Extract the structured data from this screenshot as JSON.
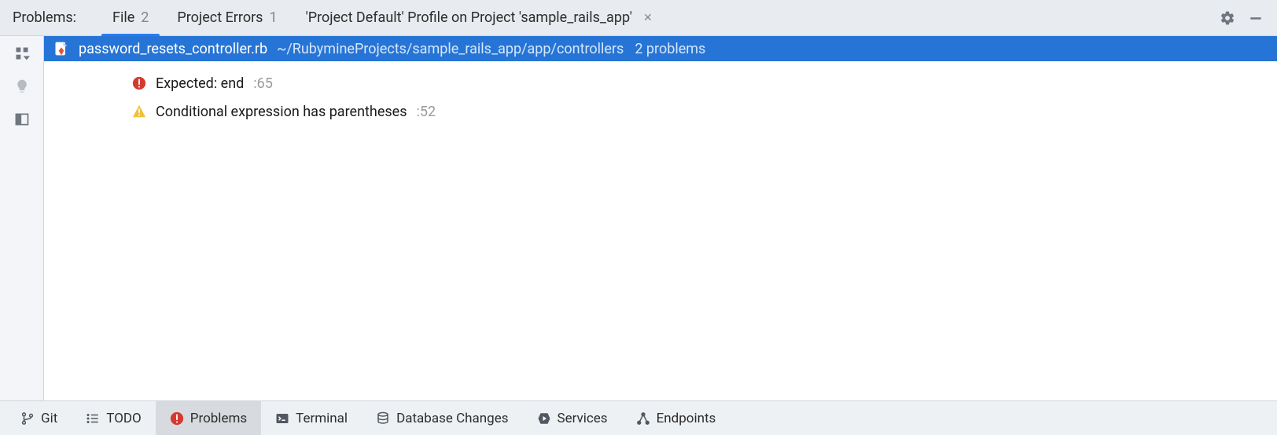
{
  "header": {
    "label": "Problems:",
    "tabs": [
      {
        "label": "File",
        "count": "2",
        "active": true
      },
      {
        "label": "Project Errors",
        "count": "1",
        "active": false
      }
    ],
    "extra_tab": {
      "label": "'Project Default' Profile on Project 'sample_rails_app'"
    }
  },
  "file": {
    "name": "password_resets_controller.rb",
    "path": "~/RubymineProjects/sample_rails_app/app/controllers",
    "summary": "2 problems"
  },
  "issues": [
    {
      "severity": "error",
      "message": "Expected: end",
      "line": ":65"
    },
    {
      "severity": "warning",
      "message": "Conditional expression has parentheses",
      "line": ":52"
    }
  ],
  "bottom_tabs": [
    {
      "id": "git",
      "label": "Git"
    },
    {
      "id": "todo",
      "label": "TODO"
    },
    {
      "id": "problems",
      "label": "Problems",
      "active": true
    },
    {
      "id": "terminal",
      "label": "Terminal"
    },
    {
      "id": "dbchanges",
      "label": "Database Changes"
    },
    {
      "id": "services",
      "label": "Services"
    },
    {
      "id": "endpoints",
      "label": "Endpoints"
    }
  ]
}
